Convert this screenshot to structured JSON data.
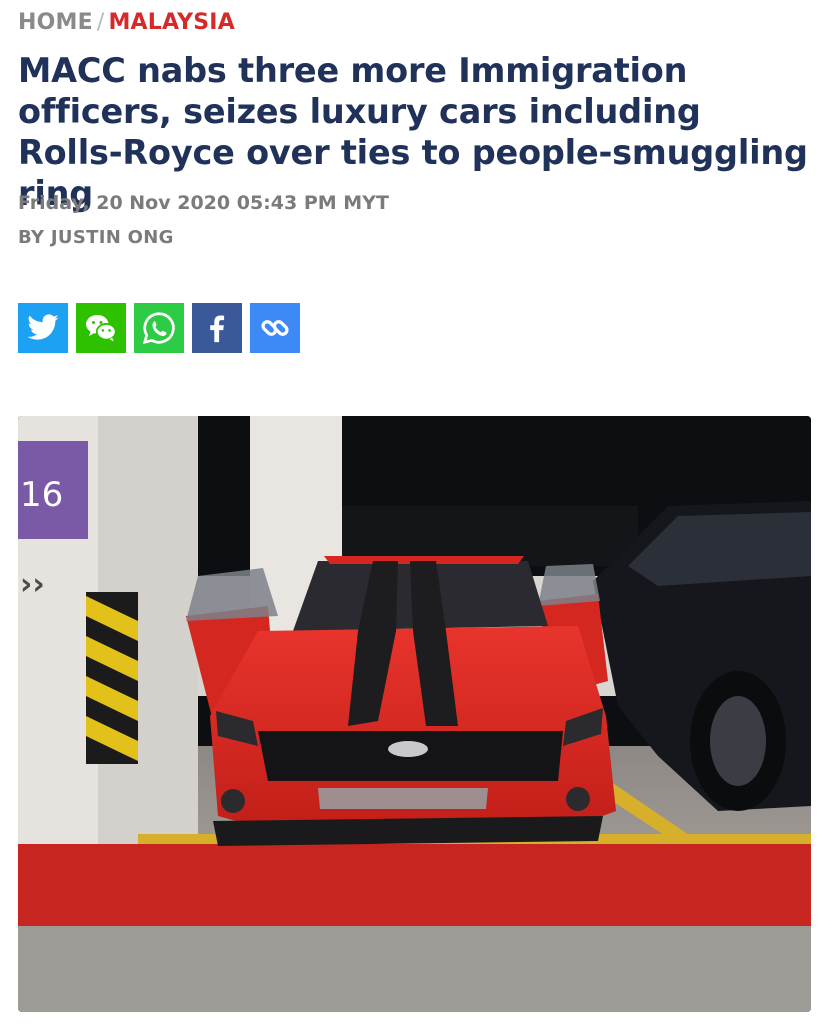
{
  "breadcrumb": {
    "home": "HOME",
    "separator": "/",
    "section": "MALAYSIA"
  },
  "article": {
    "headline": "MACC nabs three more Immigration officers, seizes luxury cars including Rolls-Royce over ties to people-smuggling ring",
    "dateline": "Friday, 20 Nov 2020 05:43 PM MYT",
    "byline": "BY JUSTIN ONG"
  },
  "share": [
    {
      "icon": "twitter-icon",
      "color": "#1da1f2"
    },
    {
      "icon": "wechat-icon",
      "color": "#2dc100"
    },
    {
      "icon": "whatsapp-icon",
      "color": "#2ecc44"
    },
    {
      "icon": "facebook-icon",
      "color": "#3b5998"
    },
    {
      "icon": "link-icon",
      "color": "#3d8af7"
    }
  ],
  "photo": {
    "pillar_sign": "16"
  },
  "colors": {
    "headline": "#20325a",
    "section": "#d42a2a",
    "meta": "#7b7b7b"
  }
}
